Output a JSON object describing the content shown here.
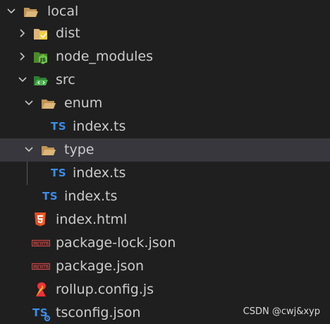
{
  "colors": {
    "background": "#1f1f1f",
    "selected_row": "#37373d",
    "folder": "#dcb67a",
    "typescript": "#3b8eea",
    "html5": "#e44d26",
    "npm": "#c74545",
    "rollup": "#ef3335",
    "guide": "#585858"
  },
  "tree": {
    "root": {
      "label": "local",
      "state": "expanded",
      "icon": "folder-open-icon"
    },
    "dist": {
      "label": "dist",
      "state": "collapsed",
      "icon": "folder-dist-icon"
    },
    "node_modules": {
      "label": "node_modules",
      "state": "collapsed",
      "icon": "folder-node-icon"
    },
    "src": {
      "label": "src",
      "state": "expanded",
      "icon": "folder-src-icon"
    },
    "enum": {
      "label": "enum",
      "state": "expanded",
      "icon": "folder-open-icon"
    },
    "enum_index": {
      "label": "index.ts",
      "badge": "TS",
      "icon": "typescript-icon"
    },
    "type": {
      "label": "type",
      "state": "expanded",
      "selected": true,
      "icon": "folder-open-icon"
    },
    "type_index": {
      "label": "index.ts",
      "badge": "TS",
      "icon": "typescript-icon"
    },
    "src_index": {
      "label": "index.ts",
      "badge": "TS",
      "icon": "typescript-icon"
    },
    "index_html": {
      "label": "index.html",
      "icon": "html5-icon"
    },
    "package_lock": {
      "label": "package-lock.json",
      "icon": "npm-icon"
    },
    "package_json": {
      "label": "package.json",
      "icon": "npm-icon"
    },
    "rollup_config": {
      "label": "rollup.config.js",
      "icon": "rollup-icon"
    },
    "tsconfig": {
      "label": "tsconfig.json",
      "badge": "TS",
      "icon": "tsconfig-icon"
    }
  },
  "watermark": "CSDN @cwj&xyp"
}
